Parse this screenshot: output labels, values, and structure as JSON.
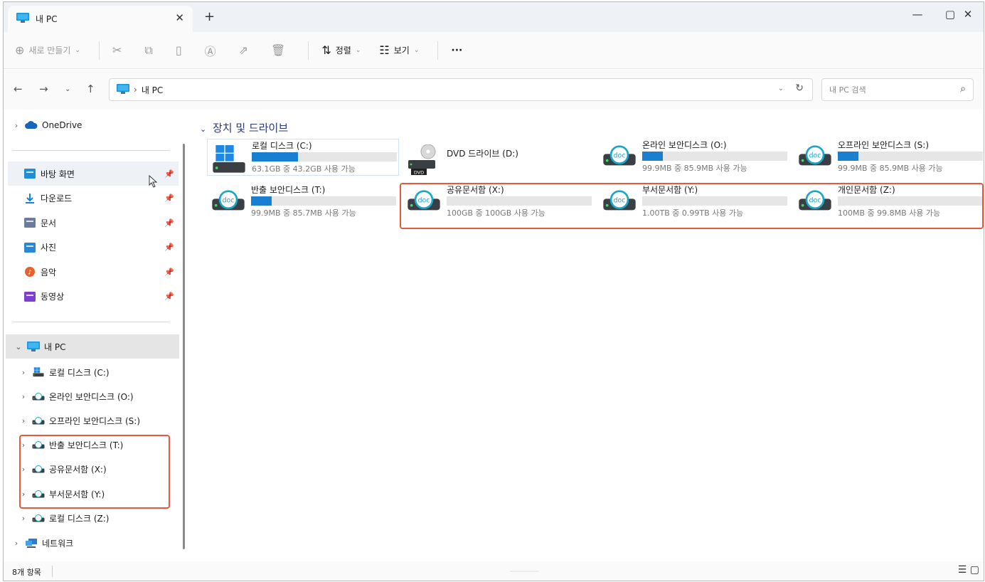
{
  "window": {
    "tab_title": "내 PC",
    "tab_close": "✕",
    "new_tab": "+",
    "controls": {
      "minimize": "—",
      "maximize": "▢",
      "close": "✕"
    }
  },
  "toolbar": {
    "new_label": "새로 만들기",
    "sort_label": "정렬",
    "view_label": "보기",
    "more_label": "···"
  },
  "address": {
    "crumb": "내 PC",
    "search_placeholder": "내 PC 검색"
  },
  "nav": {
    "onedrive": "OneDrive",
    "quick": [
      {
        "label": "바탕 화면",
        "icon": "desktop-icon"
      },
      {
        "label": "다운로드",
        "icon": "download-icon"
      },
      {
        "label": "문서",
        "icon": "documents-icon"
      },
      {
        "label": "사진",
        "icon": "pictures-icon"
      },
      {
        "label": "음악",
        "icon": "music-icon"
      },
      {
        "label": "동영상",
        "icon": "videos-icon"
      }
    ],
    "this_pc": "내 PC",
    "drives": [
      "로컬 디스크 (C:)",
      "온라인 보안디스크 (O:)",
      "오프라인 보안디스크 (S:)",
      "반출 보안디스크 (T:)",
      "공유문서함 (X:)",
      "부서문서함 (Y:)",
      "로컬 디스크 (Z:)"
    ],
    "network": "네트워크"
  },
  "content": {
    "group_title": "장치 및 드라이브",
    "drives": [
      {
        "name": "로컬 디스크 (C:)",
        "size": "63.1GB 중 43.2GB 사용 가능",
        "used_fraction": 0.32,
        "icon": "local-disk-icon"
      },
      {
        "name": "DVD 드라이브 (D:)",
        "size": "",
        "used_fraction": null,
        "icon": "dvd-drive-icon",
        "dvd_text": "DVD"
      },
      {
        "name": "온라인 보안디스크 (O:)",
        "size": "99.9MB 중 85.9MB 사용 가능",
        "used_fraction": 0.14,
        "icon": "secure-disk-icon"
      },
      {
        "name": "오프라인 보안디스크 (S:)",
        "size": "99.9MB 중 85.9MB 사용 가능",
        "used_fraction": 0.14,
        "icon": "secure-disk-icon"
      },
      {
        "name": "반출 보안디스크 (T:)",
        "size": "99.9MB 중 85.7MB 사용 가능",
        "used_fraction": 0.14,
        "icon": "secure-disk-icon"
      },
      {
        "name": "공유문서함 (X:)",
        "size": "100GB 중 100GB 사용 가능",
        "used_fraction": 0.0,
        "icon": "secure-disk-icon"
      },
      {
        "name": "부서문서함 (Y:)",
        "size": "1.00TB 중 0.99TB 사용 가능",
        "used_fraction": 0.0,
        "icon": "secure-disk-icon"
      },
      {
        "name": "개인문서함 (Z:)",
        "size": "100MB 중 99.8MB 사용 가능",
        "used_fraction": 0.0,
        "icon": "secure-disk-icon"
      }
    ],
    "doc_text": "doc"
  },
  "status": {
    "item_count": "8개 항목"
  },
  "colors": {
    "accent": "#1b7fd1",
    "highlight": "#e8583a",
    "group_title": "#2a3a78"
  }
}
